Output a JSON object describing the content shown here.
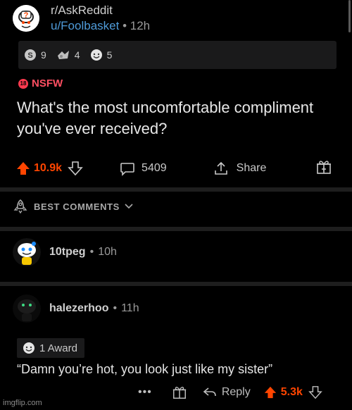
{
  "post": {
    "subreddit": "r/AskReddit",
    "author": "u/Foolbasket",
    "separator": "•",
    "age": "12h",
    "awards": [
      {
        "icon": "silver-award-icon",
        "count": "9"
      },
      {
        "icon": "helpful-award-icon",
        "count": "4"
      },
      {
        "icon": "wholesome-award-icon",
        "count": "5"
      }
    ],
    "nsfw_badge": "18",
    "nsfw_label": "NSFW",
    "title": "What's the most uncomfortable compliment you've ever received?",
    "score": "10.9k",
    "comment_count": "5409",
    "share_label": "Share"
  },
  "sort": {
    "label": "BEST COMMENTS"
  },
  "comments": [
    {
      "author": "10tpeg",
      "separator": "•",
      "age": "10h"
    },
    {
      "author": "halezerhoo",
      "separator": "•",
      "age": "11h",
      "award_label": "1 Award",
      "body": "“Damn you’re hot, you look just like my sister”",
      "more": "•••",
      "reply_label": "Reply",
      "score": "5.3k"
    }
  ],
  "colors": {
    "upvote": "#ff4500",
    "link": "#4f9bd9",
    "nsfw": "#ff4f62",
    "background": "#000000"
  },
  "watermark": "imgflip.com"
}
